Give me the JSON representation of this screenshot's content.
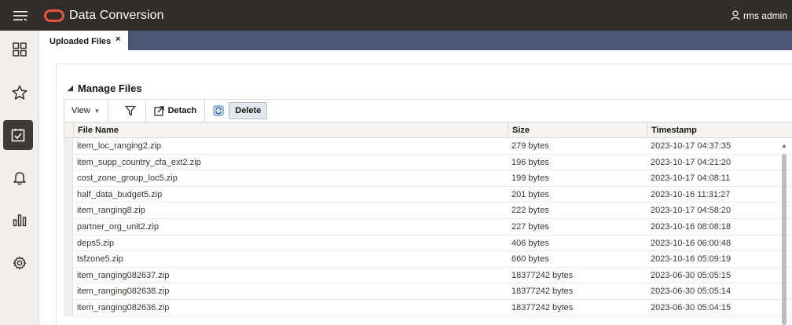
{
  "header": {
    "app_title": "Data Conversion",
    "user_name": "rms admin"
  },
  "sidebar": {
    "items": [
      {
        "icon": "dashboard-icon"
      },
      {
        "icon": "star-icon"
      },
      {
        "icon": "task-checklist-icon",
        "active": true
      },
      {
        "icon": "bell-icon"
      },
      {
        "icon": "bar-chart-icon"
      },
      {
        "icon": "gear-icon"
      }
    ]
  },
  "tabs": [
    {
      "label": "Uploaded Files",
      "close": "×"
    }
  ],
  "section": {
    "title": "Manage Files"
  },
  "toolbar": {
    "view_label": "View",
    "detach_label": "Detach",
    "delete_label": "Delete"
  },
  "table": {
    "columns": [
      "File Name",
      "Size",
      "Timestamp"
    ],
    "rows": [
      [
        "item_loc_ranging2.zip",
        "279 bytes",
        "2023-10-17 04:37:35"
      ],
      [
        "item_supp_country_cfa_ext2.zip",
        "196 bytes",
        "2023-10-17 04:21:20"
      ],
      [
        "cost_zone_group_loc5.zip",
        "199 bytes",
        "2023-10-17 04:08:11"
      ],
      [
        "half_data_budget5.zip",
        "201 bytes",
        "2023-10-16 11:31:27"
      ],
      [
        "item_ranging8.zip",
        "222 bytes",
        "2023-10-17 04:58:20"
      ],
      [
        "partner_org_unit2.zip",
        "227 bytes",
        "2023-10-16 08:08:18"
      ],
      [
        "deps5.zip",
        "406 bytes",
        "2023-10-16 06:00:48"
      ],
      [
        "tsfzone5.zip",
        "660 bytes",
        "2023-10-16 05:09:19"
      ],
      [
        "item_ranging082637.zip",
        "18377242 bytes",
        "2023-06-30 05:05:15"
      ],
      [
        "item_ranging082638.zip",
        "18377242 bytes",
        "2023-06-30 05:05:14"
      ],
      [
        "item_ranging082636.zip",
        "18377242 bytes",
        "2023-06-30 05:04:15"
      ]
    ]
  },
  "colors": {
    "topbar": "#312d2a",
    "tabstrip": "#4b5574",
    "sidebar": "#f1efed",
    "sidebar_active": "#3f3a37",
    "oracle_red": "#e5533d"
  }
}
